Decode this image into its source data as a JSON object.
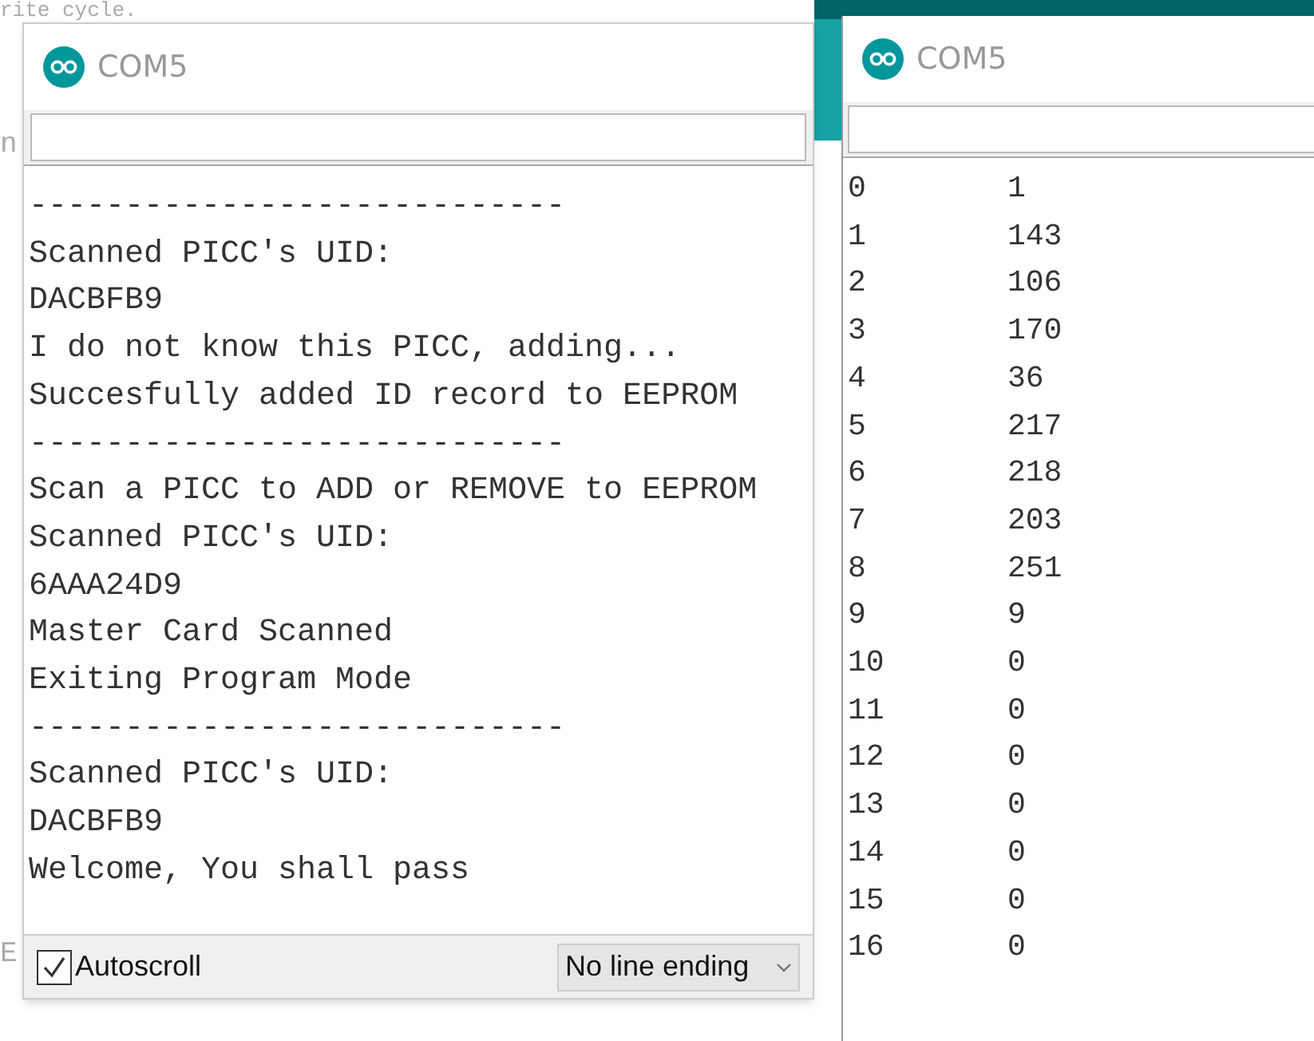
{
  "background_code": [
    "rite cycle.",
    "n",
    "E"
  ],
  "left_monitor": {
    "title": "COM5",
    "output": [
      "----------------------------",
      "Scanned PICC's UID:",
      "DACBFB9",
      "I do not know this PICC, adding...",
      "Succesfully added ID record to EEPROM",
      "----------------------------",
      "Scan a PICC to ADD or REMOVE to EEPROM",
      "Scanned PICC's UID:",
      "6AAA24D9",
      "Master Card Scanned",
      "Exiting Program Mode",
      "----------------------------",
      "Scanned PICC's UID:",
      "DACBFB9",
      "Welcome, You shall pass"
    ],
    "autoscroll": {
      "label": "Autoscroll",
      "checked": true
    },
    "line_ending": {
      "value": "No line ending"
    }
  },
  "right_monitor": {
    "title": "COM5",
    "rows": [
      [
        "0",
        "1"
      ],
      [
        "1",
        "143"
      ],
      [
        "2",
        "106"
      ],
      [
        "3",
        "170"
      ],
      [
        "4",
        "36"
      ],
      [
        "5",
        "217"
      ],
      [
        "6",
        "218"
      ],
      [
        "7",
        "203"
      ],
      [
        "8",
        "251"
      ],
      [
        "9",
        "9"
      ],
      [
        "10",
        "0"
      ],
      [
        "11",
        "0"
      ],
      [
        "12",
        "0"
      ],
      [
        "13",
        "0"
      ],
      [
        "14",
        "0"
      ],
      [
        "15",
        "0"
      ],
      [
        "16",
        "0"
      ]
    ]
  }
}
